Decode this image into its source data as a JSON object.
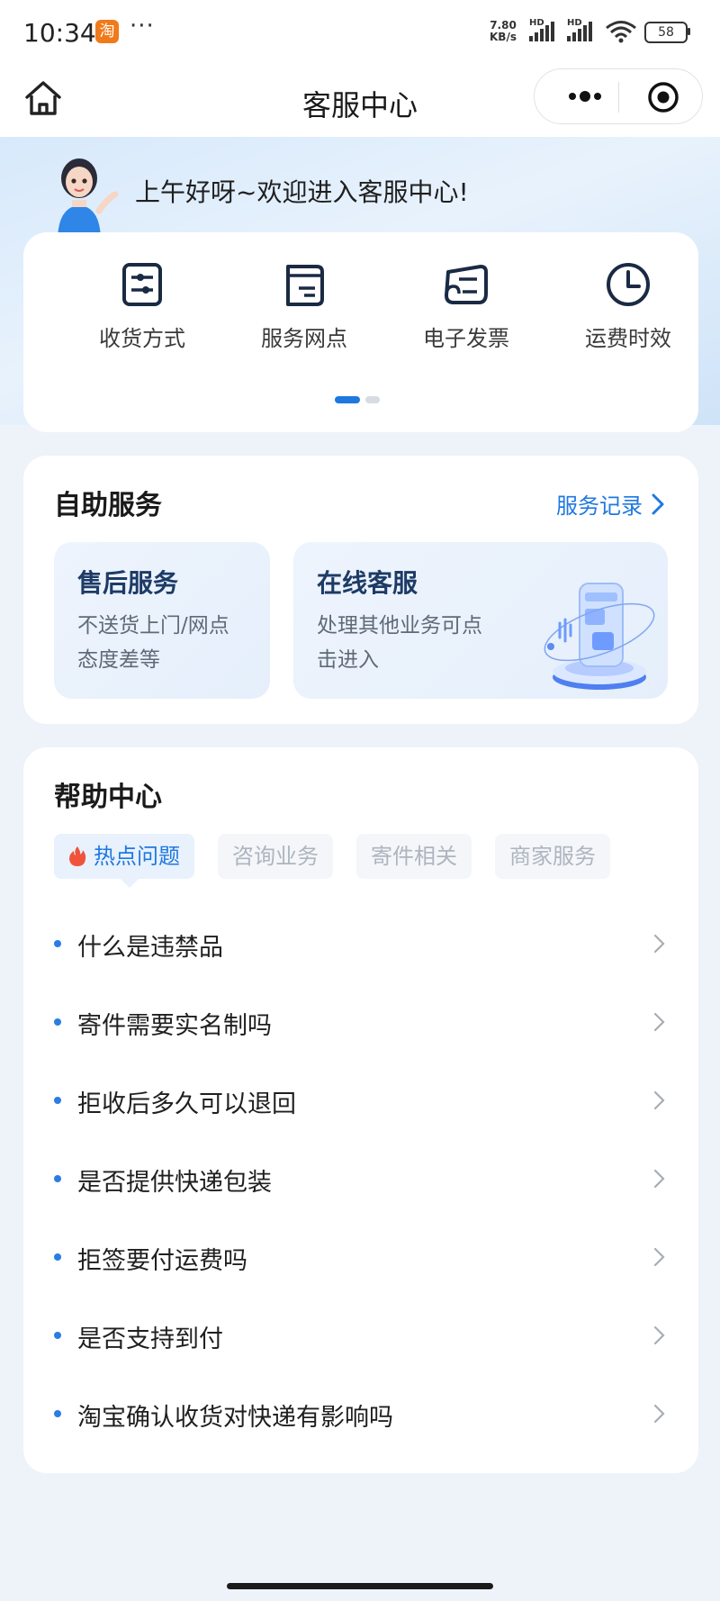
{
  "status_bar": {
    "time": "10:34",
    "app_badge": "淘",
    "more_dots": "···",
    "net_speed_value": "7.80",
    "net_speed_unit": "KB/s",
    "hd_label": "HD",
    "battery": "58"
  },
  "nav": {
    "title": "客服中心"
  },
  "hero": {
    "greeting": "上午好呀~欢迎进入客服中心!"
  },
  "quick_actions": [
    {
      "label": "收货方式",
      "icon": "receive-method-icon"
    },
    {
      "label": "服务网点",
      "icon": "service-outlet-icon"
    },
    {
      "label": "电子发票",
      "icon": "e-invoice-icon"
    },
    {
      "label": "运费时效",
      "icon": "clock-icon"
    }
  ],
  "pager": {
    "pages": 2,
    "active": 1
  },
  "self_service": {
    "title": "自助服务",
    "records_link": "服务记录",
    "cards": [
      {
        "title": "售后服务",
        "desc_line1": "不送货上门/网点",
        "desc_line2": "态度差等"
      },
      {
        "title": "在线客服",
        "desc_line1": "处理其他业务可点",
        "desc_line2": "击进入"
      }
    ]
  },
  "help_center": {
    "title": "帮助中心",
    "tabs": [
      "热点问题",
      "咨询业务",
      "寄件相关",
      "商家服务"
    ],
    "active_tab": 0,
    "faqs": [
      "什么是违禁品",
      "寄件需要实名制吗",
      "拒收后多久可以退回",
      "是否提供快递包装",
      "拒签要付运费吗",
      "是否支持到付",
      "淘宝确认收货对快递有影响吗"
    ]
  },
  "colors": {
    "accent": "#1f78e0",
    "page_bg": "#eef3fa",
    "title_dark": "#1d3b66",
    "hot_icon": "#f0533b"
  }
}
